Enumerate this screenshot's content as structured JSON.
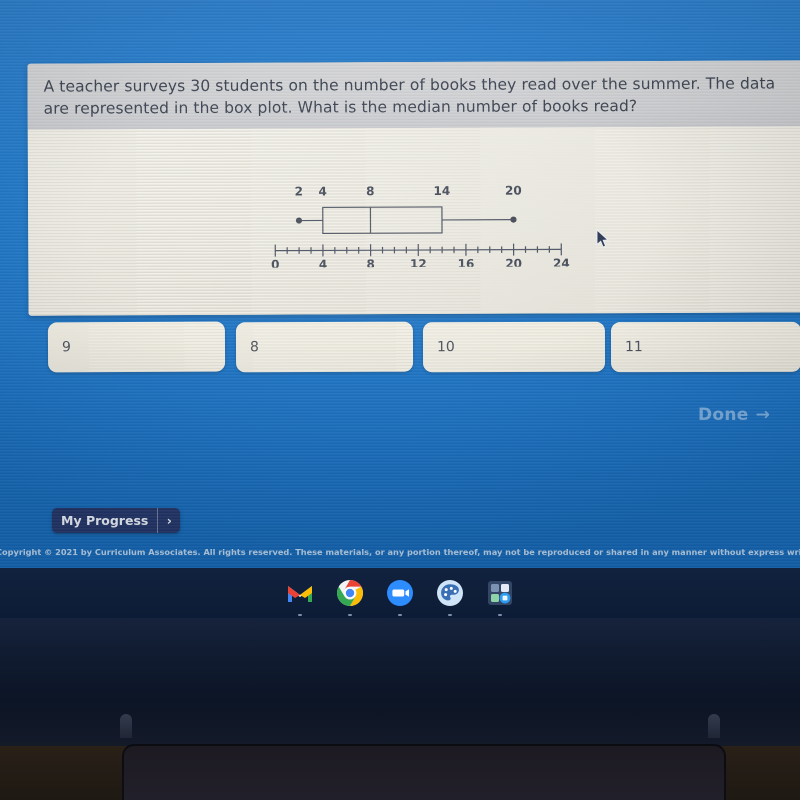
{
  "question": {
    "text": "A teacher surveys 30 students on the number of books they read over the summer. The data are represented in the box plot. What is the median number of books read?"
  },
  "chart_data": {
    "type": "box",
    "title": "",
    "xlabel": "",
    "ylabel": "",
    "xlim": [
      0,
      24
    ],
    "grid": false,
    "major_tick_step": 4,
    "minor_tick_step": 1,
    "tick_labels": [
      "0",
      "4",
      "8",
      "12",
      "16",
      "20",
      "24"
    ],
    "tick_values": [
      0,
      4,
      8,
      12,
      16,
      20,
      24
    ],
    "value_labels": [
      "2",
      "4",
      "8",
      "14",
      "20"
    ],
    "summary": {
      "min": 2,
      "q1": 4,
      "median": 8,
      "q3": 14,
      "max": 20
    }
  },
  "answers": {
    "options": [
      {
        "label": "9"
      },
      {
        "label": "8"
      },
      {
        "label": "10"
      },
      {
        "label": "11"
      }
    ]
  },
  "footer": {
    "done_label": "Done",
    "done_arrow": "→",
    "my_progress_label": "My Progress",
    "my_progress_chevron": "›",
    "copyright": "Copyright © 2021 by Curriculum Associates. All rights reserved. These materials, or any portion thereof, may not be reproduced or shared in any manner without express written consent of Curriculum Associates, LLC."
  },
  "taskbar": {
    "icons": [
      {
        "name": "gmail-icon",
        "title": "Gmail"
      },
      {
        "name": "chrome-icon",
        "title": "Chrome"
      },
      {
        "name": "zoom-icon",
        "title": "Zoom"
      },
      {
        "name": "palette-icon",
        "title": "Art"
      },
      {
        "name": "app-grid-icon",
        "title": "Apps"
      }
    ]
  },
  "colors": {
    "screen_blue": "#1d73c6",
    "card_cream": "#eeebdf",
    "card_header_gray": "#cfd0d3",
    "plot_ink": "#3e4553",
    "progress_navy": "#23366b"
  }
}
